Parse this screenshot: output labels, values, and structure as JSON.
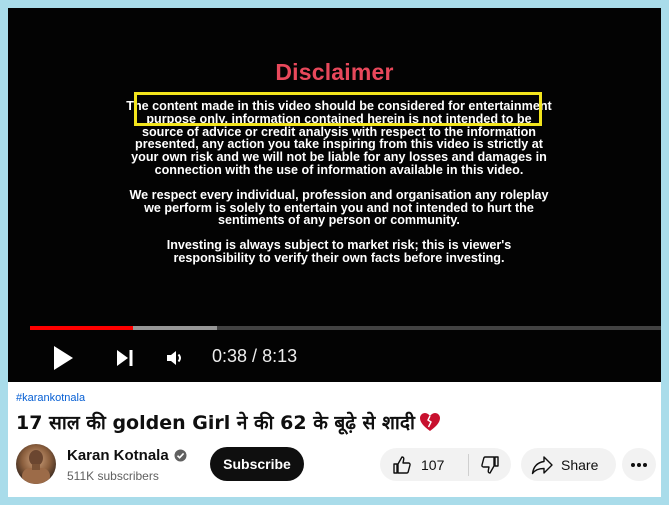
{
  "video": {
    "disclaimer_title": "Disclaimer",
    "disclaimer_paragraphs": [
      "The content made in this video should be considered for entertainment purpose only, information contained herein is not intended to be source of advice or credit analysis with respect to the information presented, any action you take inspiring from this video is strictly at your own risk and we will not be liable for any losses and damages in connection with the use of information available in this video.",
      "We respect every individual, profession and organisation any roleplay we perform is solely to entertain you and not intended to hurt the sentiments of any person or community.",
      "Investing is always subject to market risk; this is viewer's responsibility to verify their own facts before investing."
    ],
    "current_time": "0:38",
    "time_separator": " / ",
    "duration": "8:13",
    "progress_fraction": 0.163,
    "buffered_fraction": 0.296,
    "colors": {
      "progress": "#ff0000",
      "disclaimer_title": "#e8485b",
      "highlight_box": "#f3e51d"
    }
  },
  "meta": {
    "hashtag": "#karankotnala",
    "title": "17 साल की golden Girl ने की 62 के बूढ़े से शादी",
    "title_emoji_icon": "broken-heart-icon"
  },
  "channel": {
    "name": "Karan Kotnala",
    "verified_icon": "verified-check-icon",
    "subscribers": "511K subscribers",
    "subscribe_label": "Subscribe"
  },
  "actions": {
    "like_count": "107",
    "share_label": "Share",
    "icons": [
      "thumbs-up-icon",
      "thumbs-down-icon",
      "share-arrow-icon",
      "more-dots-icon"
    ]
  }
}
